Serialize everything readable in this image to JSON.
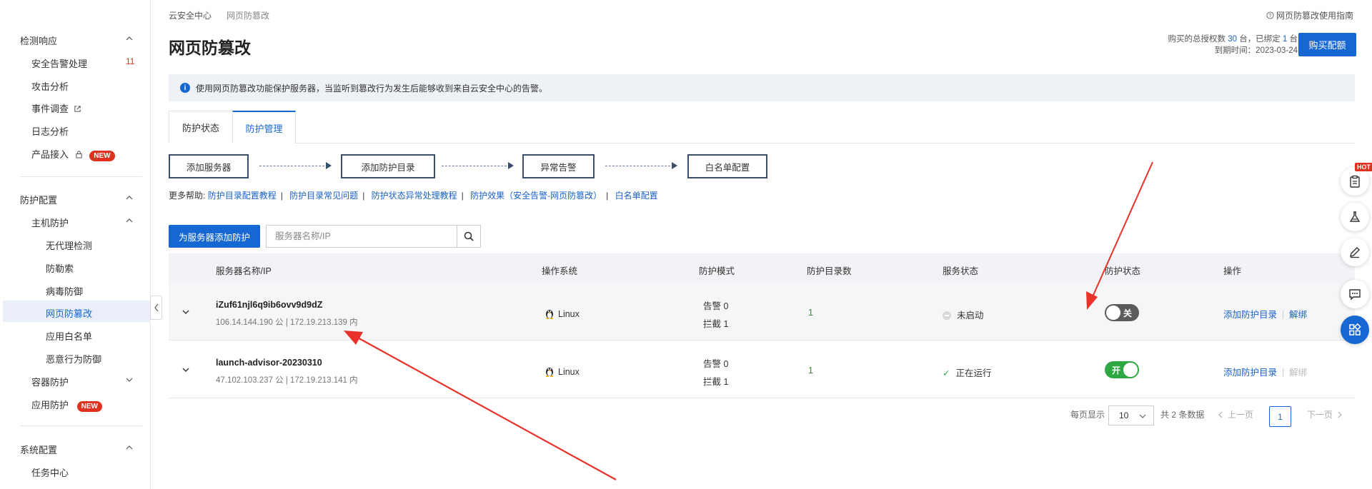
{
  "sidebar": {
    "groups": [
      {
        "label": "检测响应"
      },
      {
        "label": "防护配置"
      },
      {
        "label": "系统配置"
      }
    ],
    "items": [
      {
        "label": "安全告警处理",
        "badge": "11"
      },
      {
        "label": "攻击分析"
      },
      {
        "label": "事件调查"
      },
      {
        "label": "日志分析"
      },
      {
        "label": "产品接入",
        "badge": "NEW"
      },
      {
        "label": "主机防护"
      },
      {
        "label": "无代理检测"
      },
      {
        "label": "防勒索"
      },
      {
        "label": "病毒防御"
      },
      {
        "label": "网页防篡改"
      },
      {
        "label": "应用白名单"
      },
      {
        "label": "恶意行为防御"
      },
      {
        "label": "容器防护"
      },
      {
        "label": "应用防护",
        "badge": "NEW"
      },
      {
        "label": "任务中心"
      }
    ]
  },
  "header": {
    "breadcrumb": [
      "云安全中心",
      "网页防篡改"
    ],
    "breadcrumb_sep": "/",
    "title": "网页防篡改",
    "help_link": "网页防篡改使用指南",
    "quota_line1_a": "购买的总授权数",
    "quota_total": "30",
    "quota_line1_b": "台，已绑定",
    "quota_bound": "1",
    "quota_line1_c": "台",
    "quota_line2": "到期时间：2023-03-24",
    "buy_button": "购买配额"
  },
  "info_bar": "使用网页防篡改功能保护服务器，当监听到篡改行为发生后能够收到来自云安全中心的告警。",
  "tabs": [
    {
      "label": "防护状态",
      "active": false
    },
    {
      "label": "防护管理",
      "active": true
    }
  ],
  "steps": [
    "添加服务器",
    "添加防护目录",
    "异常告警",
    "白名单配置"
  ],
  "more_help": {
    "prefix": "更多帮助:",
    "links": [
      "防护目录配置教程",
      "防护目录常见问题",
      "防护状态异常处理教程",
      "防护效果（安全告警-网页防篡改）",
      "白名单配置"
    ]
  },
  "toolbar": {
    "add_button": "为服务器添加防护",
    "search_placeholder": "服务器名称/IP"
  },
  "table": {
    "columns": [
      "服务器名称/IP",
      "操作系统",
      "防护模式",
      "防护目录数",
      "服务状态",
      "防护状态",
      "操作"
    ],
    "rows": [
      {
        "name": "iZuf61njl6q9ib6ovv9d9dZ",
        "ip": "106.14.144.190 公 | 172.19.213.139 内",
        "os": "Linux",
        "mode_alert": "告警 0",
        "mode_block": "拦截 1",
        "dirs": "1",
        "service_status": "未启动",
        "protect_toggle": "关",
        "op_add": "添加防护目录",
        "op_unbind": "解绑"
      },
      {
        "name": "launch-advisor-20230310",
        "ip": "47.102.103.237 公 | 172.19.213.141 内",
        "os": "Linux",
        "mode_alert": "告警 0",
        "mode_block": "拦截 1",
        "dirs": "1",
        "service_status": "正在运行",
        "protect_toggle": "开",
        "op_add": "添加防护目录",
        "op_unbind": "解绑"
      }
    ]
  },
  "pagination": {
    "per_page_label": "每页显示",
    "per_page": "10",
    "total": "共 2 条数据",
    "prev": "上一页",
    "current": "1",
    "next": "下一页"
  },
  "float_toolbar": {
    "hot_badge": "HOT"
  },
  "colors": {
    "primary": "#1767d2",
    "danger": "#e0301e",
    "success": "#2ea843",
    "annotation": "#e8322a"
  }
}
